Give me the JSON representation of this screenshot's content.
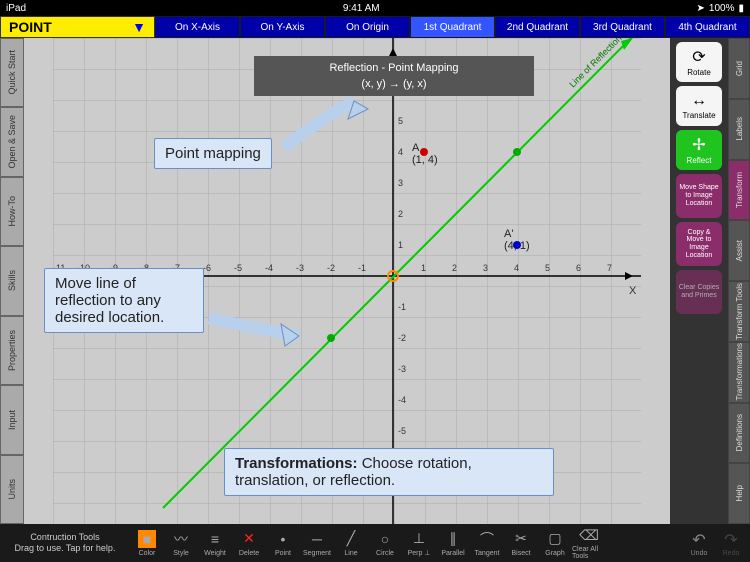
{
  "status": {
    "carrier": "iPad",
    "time": "9:41 AM",
    "battery": "100%"
  },
  "point_button": {
    "label": "POINT",
    "chevron": "▼"
  },
  "mode_tabs": [
    "On X-Axis",
    "On Y-Axis",
    "On Origin",
    "1st Quadrant",
    "2nd Quadrant",
    "3rd Quadrant",
    "4th Quadrant"
  ],
  "active_mode": 3,
  "left_tabs": [
    "Quick Start",
    "Open & Save",
    "How-To",
    "Skills",
    "Properties",
    "Input",
    "Units"
  ],
  "right_buttons": {
    "rotate": "Rotate",
    "translate": "Translate",
    "reflect": "Reflect",
    "move": "Move Shape to Image Location",
    "copy": "Copy & Move to Image Location",
    "clear": "Clear Copies and Primes"
  },
  "right_tabs": [
    "Grid",
    "Labels",
    "Transform",
    "Assist",
    "Transform Tools",
    "Transformations",
    "Definitions",
    "Help"
  ],
  "active_right": 2,
  "legend": {
    "title": "Reflection - Point Mapping",
    "formula": "(x, y) → (y, x)"
  },
  "pointA": {
    "label": "A",
    "coords": "(1, 4)"
  },
  "pointAP": {
    "label": "A'",
    "coords": "(4, 1)"
  },
  "line_label": "Line of Reflection",
  "callout1": "Point mapping",
  "callout2": "Move line of reflection to any desired location.",
  "callout3_bold": "Transformations:",
  "callout3_rest": " Choose rotation, translation, or reflection.",
  "bottom": {
    "help": "Contruction Tools\nDrag to use. Tap for help.",
    "tools": [
      "Color",
      "Style",
      "Weight",
      "Delete",
      "Point",
      "Segment",
      "Line",
      "Circle",
      "Perp ⊥",
      "Parallel",
      "Tangent",
      "Bisect",
      "Graph",
      "Clear All Tools"
    ],
    "undo": "Undo",
    "redo": "Redo"
  },
  "chart_data": {
    "type": "scatter",
    "title": "Reflection - Point Mapping",
    "xlim": [
      -11,
      8
    ],
    "ylim": [
      -7,
      8
    ],
    "points": [
      {
        "name": "A",
        "x": 1,
        "y": 4
      },
      {
        "name": "A'",
        "x": 4,
        "y": 1
      }
    ],
    "line": {
      "name": "Line of Reflection",
      "equation": "y = x",
      "through": [
        [
          -7,
          -7
        ],
        [
          8,
          8
        ]
      ]
    },
    "mapped": [
      {
        "x": 4,
        "y": 4
      },
      {
        "x": -2,
        "y": -2
      }
    ]
  }
}
